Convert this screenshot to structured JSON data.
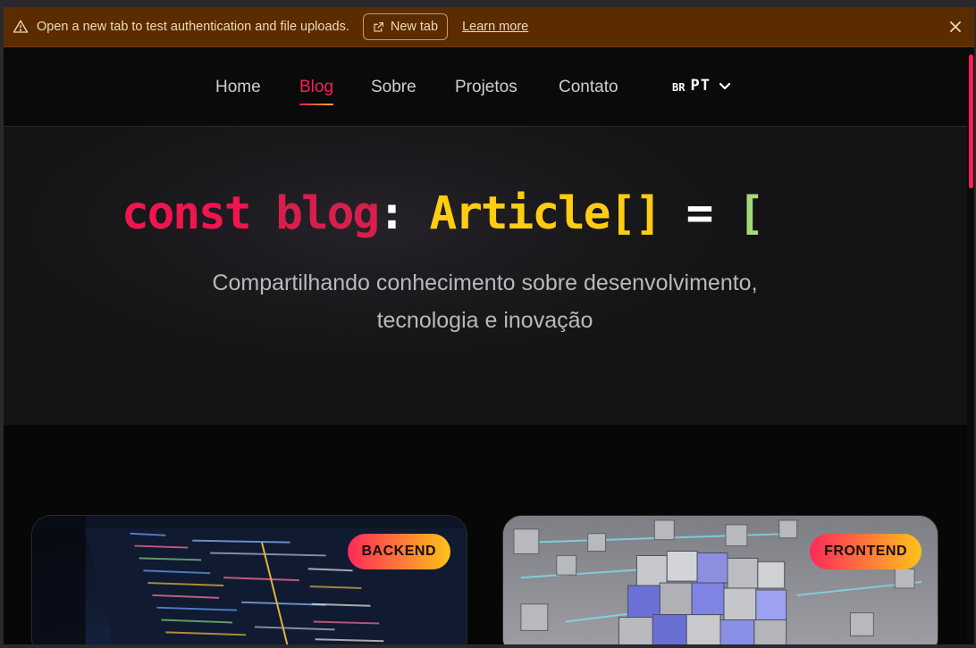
{
  "banner": {
    "message": "Open a new tab to test authentication and file uploads.",
    "new_tab_label": "New tab",
    "learn_more_label": "Learn more"
  },
  "nav": {
    "items": [
      {
        "label": "Home",
        "active": false
      },
      {
        "label": "Blog",
        "active": true
      },
      {
        "label": "Sobre",
        "active": false
      },
      {
        "label": "Projetos",
        "active": false
      },
      {
        "label": "Contato",
        "active": false
      }
    ],
    "language": {
      "flag": "BR",
      "code": "PT"
    }
  },
  "hero": {
    "code": {
      "keyword": "const",
      "identifier": "blog",
      "colon": ":",
      "type": "Article[]",
      "equals": "=",
      "bracket": "["
    },
    "subtitle_line1": "Compartilhando conhecimento sobre desenvolvimento,",
    "subtitle_line2": "tecnologia e inovação"
  },
  "cards": [
    {
      "category": "BACKEND"
    },
    {
      "category": "FRONTEND"
    }
  ],
  "colors": {
    "accent": "#ff1d55",
    "accent_gradient_end": "#ffb020",
    "banner_bg": "#5a2c00",
    "type_yellow": "#ffcc14",
    "bracket_green": "#a6d97a"
  }
}
